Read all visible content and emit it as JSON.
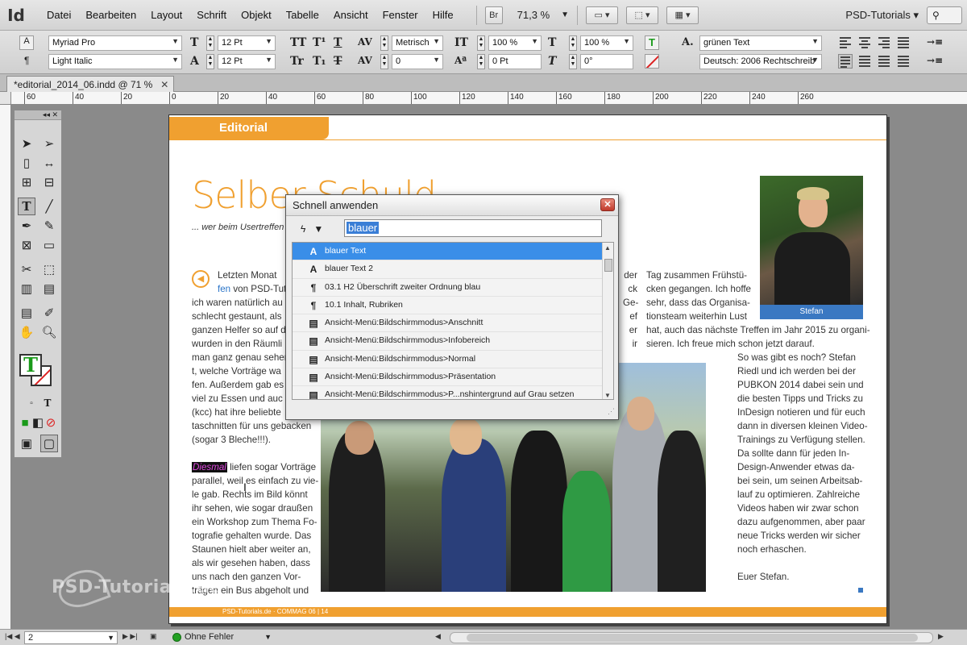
{
  "menubar": {
    "logo": "Id",
    "items": [
      "Datei",
      "Bearbeiten",
      "Layout",
      "Schrift",
      "Objekt",
      "Tabelle",
      "Ansicht",
      "Fenster",
      "Hilfe"
    ],
    "bridge": "Br",
    "zoom": "71,3 %",
    "workspace": "PSD-Tutorials"
  },
  "control": {
    "font_family": "Myriad Pro",
    "font_style": "Light Italic",
    "font_size": "12 Pt",
    "leading": "12 Pt",
    "kerning": "Metrisch",
    "tracking": "0",
    "vscale": "100 %",
    "hscale": "100 %",
    "baseline": "0 Pt",
    "skew": "0°",
    "char_style": "grünen Text",
    "language": "Deutsch: 2006 Rechtschreib"
  },
  "document": {
    "tab_label": "*editorial_2014_06.indd @ 71 %",
    "ruler_labels": [
      "60",
      "40",
      "20",
      "0",
      "20",
      "40",
      "60",
      "80",
      "100",
      "120",
      "140",
      "160",
      "180",
      "200",
      "220",
      "240",
      "260"
    ]
  },
  "page": {
    "section": "Editorial",
    "headline": "Selber Schuld",
    "subline": "... wer beim Usertreffen",
    "col1": [
      "Letzten Monat",
      "fen von PSD-Tuto",
      "ich waren natürlich au",
      "schlecht gestaunt, als",
      "ganzen Helfer so auf d",
      "wurden in den Räumli",
      "man ganz genau sehen",
      "t, welche Vorträge wa",
      "fen. Außerdem gab es e",
      "viel zu Essen und auc",
      "(kcc) hat ihre beliebte",
      "taschnitten für uns gebacken",
      "(sogar 3 Bleche!!!)."
    ],
    "col1b_word": "Diesmal",
    "col1b": [
      " liefen sogar Vorträge",
      "parallel, weil es einfach zu vie-",
      "le gab. Rechts im Bild könnt",
      "ihr sehen, wie sogar draußen",
      "ein Workshop zum Thema Fo-",
      "tografie gehalten wurde. Das",
      "Staunen hielt aber weiter an,",
      "als wir gesehen haben, dass",
      "uns nach den ganzen Vor-",
      "trägen ein Bus abgeholt und"
    ],
    "col2_edge": [
      "der",
      "ck",
      "Ge-",
      "ef",
      "er",
      "ir"
    ],
    "col3": [
      "Tag zusammen Frühstü-",
      "cken gegangen. Ich hoffe",
      "sehr, dass das Organisa-",
      "tionsteam weiterhin Lust",
      "hat, auch das nächste Treffen im Jahr 2015 zu organi-",
      "sieren. Ich freue mich schon jetzt darauf."
    ],
    "col4": [
      "So was gibt es noch? Stefan",
      "Riedl und ich werden bei der",
      "PUBKON 2014 dabei sein und",
      "die besten Tipps und Tricks zu",
      "InDesign notieren und für euch",
      "dann in diversen kleinen Video-",
      "Trainings zu Verfügung stellen.",
      "Da sollte dann für jeden In-",
      "Design-Anwender etwas da-",
      "bei sein, um seinen Arbeitsab-",
      "lauf zu optimieren. Zahlreiche",
      "Videos haben wir zwar schon",
      "dazu aufgenommen, aber paar",
      "neue Tricks werden wir sicher",
      "noch erhaschen.",
      "",
      "Euer Stefan."
    ],
    "caption": "Stefan",
    "footer": "PSD-Tutorials.de · COMMAG 06 | 14"
  },
  "dialog": {
    "title": "Schnell anwenden",
    "query": "blauer",
    "items": [
      {
        "icon": "A",
        "label": "blauer Text"
      },
      {
        "icon": "A",
        "label": "blauer Text 2"
      },
      {
        "icon": "¶",
        "label": "03.1 H2 Überschrift zweiter Ordnung blau"
      },
      {
        "icon": "¶",
        "label": "10.1 Inhalt, Rubriken"
      },
      {
        "icon": "▤",
        "label": "Ansicht-Menü:Bildschirmmodus>Anschnitt"
      },
      {
        "icon": "▤",
        "label": "Ansicht-Menü:Bildschirmmodus>Infobereich"
      },
      {
        "icon": "▤",
        "label": "Ansicht-Menü:Bildschirmmodus>Normal"
      },
      {
        "icon": "▤",
        "label": "Ansicht-Menü:Bildschirmmodus>Präsentation"
      },
      {
        "icon": "▤",
        "label": "Ansicht-Menü:Bildschirmmodus>P...nshintergrund auf Grau setzen"
      }
    ]
  },
  "status": {
    "page": "2",
    "preflight": "Ohne Fehler"
  },
  "watermark": "PSD-Tutorials.de",
  "colors": {
    "accent_orange": "#f0a030",
    "selection_blue": "#3a8ee8",
    "caption_blue": "#3a78c2"
  }
}
